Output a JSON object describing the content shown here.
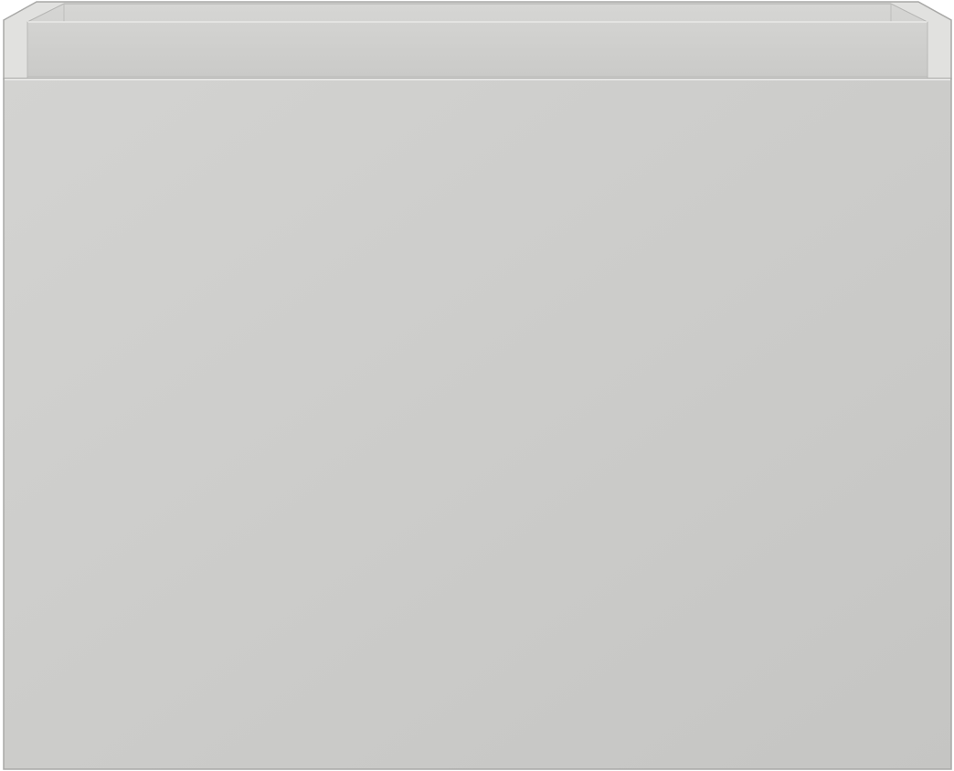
{
  "product": {
    "description_visible": false,
    "colors": {
      "body_light": "#d1d1cf",
      "body_dark": "#c6c6c4",
      "rim_top": "#e2e2e0",
      "inner_back": "#cfcfcd",
      "edge": "#aaaaa8",
      "highlight": "#f3f3f2",
      "background": "#ffffff"
    }
  }
}
